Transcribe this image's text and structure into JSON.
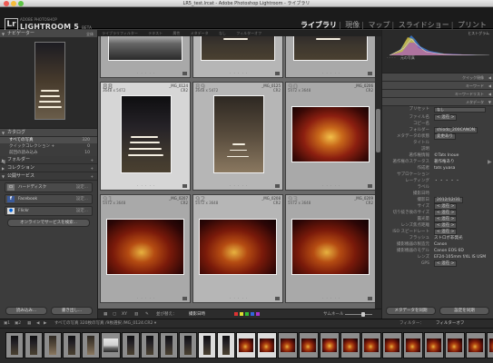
{
  "window": {
    "title": "LR5_test.lrcat - Adobe Photoshop Lightroom - ライブラリ"
  },
  "identity": {
    "small": "ADOBE PHOTOSHOP",
    "name": "LIGHTROOM 5",
    "beta": "BETA",
    "logo": "Lr"
  },
  "modules": [
    {
      "label": "ライブラリ",
      "active": true
    },
    {
      "label": "現像",
      "active": false
    },
    {
      "label": "マップ",
      "active": false
    },
    {
      "label": "スライドショー",
      "active": false
    },
    {
      "label": "プリント",
      "active": false
    }
  ],
  "left_panel": {
    "navigator_label": "ナビゲーター",
    "navigator_fit": "全体",
    "catalog": {
      "header": "カタログ",
      "items": [
        {
          "label": "すべての写真",
          "count": "320",
          "selected": true
        },
        {
          "label": "クイックコレクション +",
          "count": "0",
          "selected": false
        },
        {
          "label": "前回の読み込み",
          "count": "10",
          "selected": false
        }
      ]
    },
    "sections": [
      "フォルダー",
      "コレクション",
      "公開サービス"
    ],
    "services": [
      {
        "label": "ハードディスク",
        "action": "設定...",
        "icon": "hd-icon"
      },
      {
        "label": "Facebook",
        "action": "設定...",
        "icon": "facebook-icon"
      },
      {
        "label": "Flickr",
        "action": "設定...",
        "icon": "flickr-icon"
      }
    ],
    "online_button": "オンラインでサービスを検索...",
    "import_button": "読み込み...",
    "export_button": "書き出し..."
  },
  "center": {
    "filter_bar": [
      "ライブラリフィルター",
      "テキスト",
      "属性",
      "メタデータ",
      "なし",
      "フィルターオフ"
    ],
    "rows": [
      {
        "cells": [
          {
            "index": "",
            "name": "",
            "size": "",
            "ext": "",
            "photo": "sky"
          },
          {
            "index": "",
            "name": "",
            "size": "",
            "ext": "",
            "photo": "dark"
          },
          {
            "index": "",
            "name": "",
            "size": "",
            "ext": "",
            "photo": "dark"
          }
        ]
      },
      {
        "cells": [
          {
            "index": "88",
            "name": "_MG_0124",
            "size": "3648 x 5472",
            "ext": "CR2",
            "photo": "dark"
          },
          {
            "index": "89",
            "name": "_MG_0125",
            "size": "3648 x 5472",
            "ext": "CR2",
            "photo": "arch"
          },
          {
            "index": "90",
            "name": "_MG_0206",
            "size": "5472 x 3648",
            "ext": "CR2",
            "photo": "red"
          }
        ]
      },
      {
        "cells": [
          {
            "index": "91",
            "name": "_MG_0207",
            "size": "5472 x 3648",
            "ext": "CR2",
            "photo": "wide"
          },
          {
            "index": "92",
            "name": "_MG_0208",
            "size": "5472 x 3648",
            "ext": "CR2",
            "photo": "wide"
          },
          {
            "index": "93",
            "name": "_MG_0209",
            "size": "5472 x 3648",
            "ext": "CR2",
            "photo": "wide"
          }
        ]
      }
    ],
    "toolbar": {
      "sort_label": "並び替え：",
      "sort_value": "撮影日時",
      "thumbs_label": "サムネール"
    }
  },
  "right_panel": {
    "histogram_label": "ヒストグラム",
    "histogram_info": "元の写真",
    "quick_develop": "クイック現像",
    "keywords": "キーワード",
    "keyword_list": "キーワードリスト",
    "metadata": "メタデータ",
    "preset_label": "プリセット",
    "preset_value": "なし",
    "fields": [
      {
        "label": "ファイル名",
        "value": "< 混在 >"
      },
      {
        "label": "コピー名",
        "value": ""
      },
      {
        "label": "フォルダー",
        "value": "shiodo_200CANON"
      },
      {
        "label": "メタデータの状態",
        "value": "変更あり"
      },
      {
        "label": "タイトル",
        "value": ""
      },
      {
        "label": "説明",
        "value": ""
      },
      {
        "label": "著作権情報",
        "value": "©Tats Inoue"
      },
      {
        "label": "著作権のステータス",
        "value": "著作権あり"
      },
      {
        "label": "作成者",
        "value": "tats yuasa"
      },
      {
        "label": "サブロケーション",
        "value": ""
      },
      {
        "label": "レーティング",
        "value": "・ ・ ・ ・ ・"
      },
      {
        "label": "ラベル",
        "value": ""
      },
      {
        "label": "撮影日時",
        "value": ""
      },
      {
        "label": "撮影日",
        "value": "2012/12/31"
      },
      {
        "label": "サイズ",
        "value": "< 混在 >"
      },
      {
        "label": "切り抜き後のサイズ",
        "value": "< 混在 >"
      },
      {
        "label": "露光量",
        "value": "< 混在 >"
      },
      {
        "label": "レンズ焦点距離",
        "value": "< 混在 >"
      },
      {
        "label": "ISO スピードレート",
        "value": "< 混在 >"
      },
      {
        "label": "フラッシュ",
        "value": "ストロボ非発光"
      },
      {
        "label": "撮影機器の製造元",
        "value": "Canon"
      },
      {
        "label": "撮影機器のモデル",
        "value": "Canon EOS 6D"
      },
      {
        "label": "レンズ",
        "value": "EF24-105mm f/4L IS USM"
      },
      {
        "label": "GPS",
        "value": "< 混在 >"
      }
    ],
    "sync_button": "メタデータを同期",
    "settings_button": "設定を同期"
  },
  "filmstrip": {
    "path": "すべての写真 320枚の写真 /9枚選択 /MG_0124.CR2 ▾",
    "filter_label": "フィルター：",
    "filter_value": "フィルターオフ"
  },
  "histogram": {
    "colors": [
      "#3d7fd9",
      "#e5c932",
      "#a64ad0",
      "#cccccc"
    ]
  }
}
